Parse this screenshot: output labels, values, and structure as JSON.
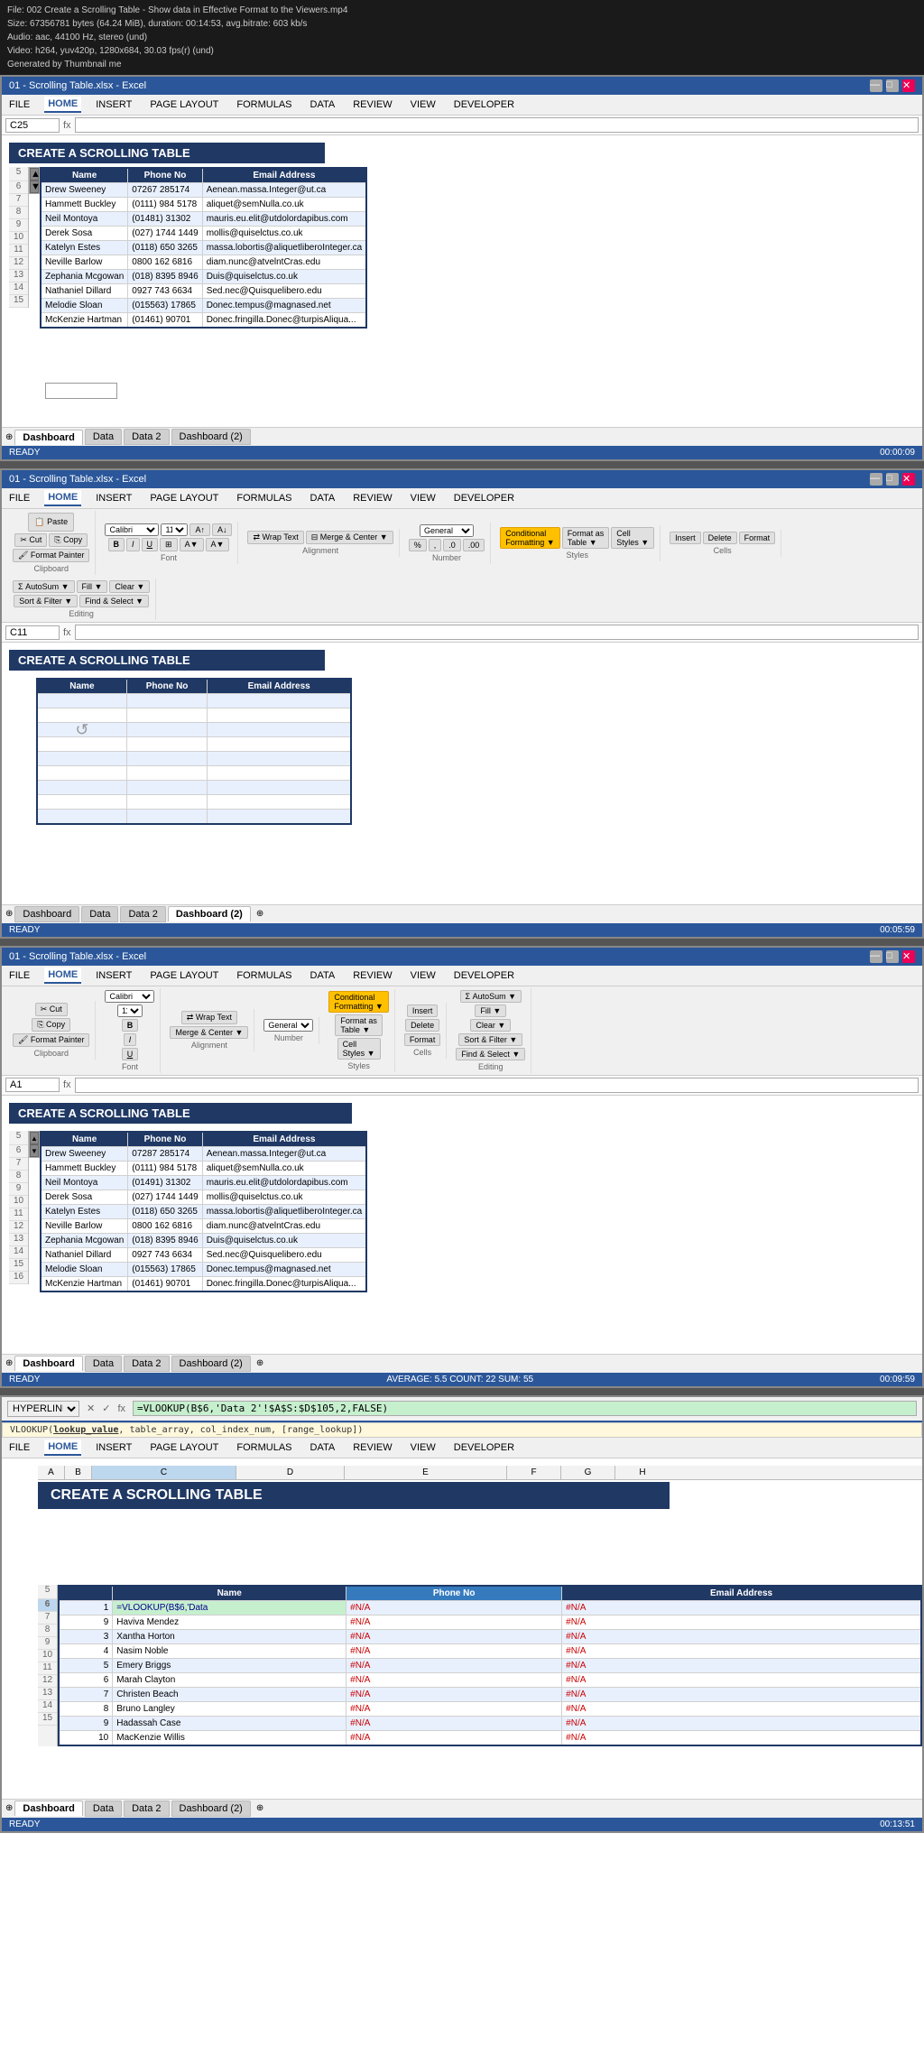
{
  "videoInfo": {
    "file": "File: 002 Create a Scrolling Table - Show data in Effective Format to the Viewers.mp4",
    "size": "Size: 67356781 bytes (64.24 MiB), duration: 00:14:53, avg.bitrate: 603 kb/s",
    "audio": "Audio: aac, 44100 Hz, stereo (und)",
    "video": "Video: h264, yuv420p, 1280x684, 30.03 fps(r) (und)",
    "generated": "Generated by Thumbnail me"
  },
  "section1": {
    "titleBar": "01 - Scrolling Table.xlsx - Excel",
    "nameBox": "C25",
    "formula": "",
    "activeTab": "HOME",
    "menuItems": [
      "FILE",
      "HOME",
      "INSERT",
      "PAGE LAYOUT",
      "FORMULAS",
      "DATA",
      "REVIEW",
      "VIEW",
      "DEVELOPER"
    ],
    "pageTitle": "CREATE A SCROLLING TABLE",
    "sheetTabs": [
      "Dashboard",
      "Data",
      "Data 2",
      "Dashboard (2)"
    ],
    "activeSheet": "Dashboard",
    "status": "READY",
    "timeCode": "00:00:09",
    "tableHeaders": [
      "Name",
      "Phone No",
      "Email Address"
    ],
    "tableData": [
      [
        "Drew Sweeney",
        "07267 285174",
        "Aenean.massa.Integer@ut.ca"
      ],
      [
        "Hammett Buckley",
        "(0111) 984 5178",
        "aliquet@semNulla.co.uk"
      ],
      [
        "Neil Montoya",
        "(01481) 31302",
        "mauris.eu.elit@utdolordapibus.com"
      ],
      [
        "Derek Sosa",
        "(027) 1744 1449",
        "mollis@quiselctus.co.uk"
      ],
      [
        "Katelyn Estes",
        "(0118) 650 3265",
        "massa.lobortis@aliquetliberoInteger.ca"
      ],
      [
        "Neville Barlow",
        "0800 162 6816",
        "diam.nunc@atvelntCras.edu"
      ],
      [
        "Zephania Mcgowan",
        "(018) 8395 8946",
        "Duis@quiselctus.co.uk"
      ],
      [
        "Nathaniel Dillard",
        "0927 743 6634",
        "Sed.nec@Quisquelibero.edu"
      ],
      [
        "Melodie Sloan",
        "(015563) 17865",
        "Donec.tempus@magnased.net"
      ],
      [
        "McKenzie Hartman",
        "(01461) 90701",
        "Donec.fringilla.Donec@turpisAliquamadipising.net"
      ]
    ]
  },
  "section2": {
    "titleBar": "01 - Scrolling Table.xlsx - Excel",
    "nameBox": "C11",
    "formula": "",
    "activeTab": "HOME",
    "menuItems": [
      "FILE",
      "HOME",
      "INSERT",
      "PAGE LAYOUT",
      "FORMULAS",
      "DATA",
      "REVIEW",
      "VIEW",
      "DEVELOPER"
    ],
    "pageTitle": "CREATE A SCROLLING TABLE",
    "sheetTabs": [
      "Dashboard",
      "Data",
      "Data 2",
      "Dashboard (2)"
    ],
    "activeSheet": "Dashboard (2)",
    "status": "READY",
    "timeCode": "00:05:59",
    "tableHeaders": [
      "Name",
      "Phone No",
      "Email Address"
    ],
    "tableData": [
      [
        "",
        "",
        ""
      ],
      [
        "",
        "",
        ""
      ],
      [
        "",
        "",
        ""
      ],
      [
        "",
        "",
        ""
      ],
      [
        "",
        "",
        ""
      ],
      [
        "",
        "",
        ""
      ],
      [
        "",
        "",
        ""
      ],
      [
        "",
        "",
        ""
      ],
      [
        "",
        "",
        ""
      ]
    ]
  },
  "section3": {
    "titleBar": "01 - Scrolling Table.xlsx - Excel",
    "nameBox": "A1",
    "formula": "",
    "activeTab": "HOME",
    "menuItems": [
      "FILE",
      "HOME",
      "INSERT",
      "PAGE LAYOUT",
      "FORMULAS",
      "DATA",
      "REVIEW",
      "VIEW",
      "DEVELOPER"
    ],
    "pageTitle": "CREATE A SCROLLING TABLE",
    "sheetTabs": [
      "Dashboard",
      "Data",
      "Data 2",
      "Dashboard (2)"
    ],
    "activeSheet": "Dashboard",
    "status": "READY",
    "timeCode": "00:09:59",
    "statusExtra": "AVERAGE: 5.5   COUNT: 22   SUM: 55",
    "tableHeaders": [
      "Name",
      "Phone No",
      "Email Address"
    ],
    "tableData": [
      [
        "Drew Sweeney",
        "07287 285174",
        "Aenean.massa.Integer@ut.ca"
      ],
      [
        "Hammett Buckley",
        "(0111) 984 5178",
        "aliquet@semNulla.co.uk"
      ],
      [
        "Neil Montoya",
        "(01491) 31302",
        "mauris.eu.elit@utdolordapibus.com"
      ],
      [
        "Derek Sosa",
        "(027) 1744 1449",
        "mollis@quiselctus.co.uk"
      ],
      [
        "Katelyn Estes",
        "(0118) 650 3265",
        "massa.lobortis@aliquetliberoInteger.ca"
      ],
      [
        "Neville Barlow",
        "0800 162 6816",
        "diam.nunc@atvelntCras.edu"
      ],
      [
        "Zephania Mcgowan",
        "(018) 8395 8946",
        "Duis@quiselctus.co.uk"
      ],
      [
        "Nathaniel Dillard",
        "0927 743 6634",
        "Sed.nec@Quisquelibero.edu"
      ],
      [
        "Melodie Sloan",
        "(015563) 17865",
        "Donec.tempus@magnased.net"
      ],
      [
        "McKenzie Hartman",
        "(01461) 90701",
        "Donec.fringilla.Donec@turpisAliquamadipising.net"
      ]
    ]
  },
  "section4": {
    "titleBar": "01 - Scrolling Table.xlsx - Excel",
    "nameBox": "HYPERLINK",
    "formula": "=VLOOKUP(B$6,'Data 2'!$A$S:$D$105,2,FALSE)",
    "formulaHint": "VLOOKUP(lookup_value, table_array, col_index_num, [range_lookup])",
    "activeTab": "HOME",
    "menuItems": [
      "FILE",
      "HOME",
      "INSERT",
      "PAGE LAYOUT",
      "FORMULAS",
      "DATA",
      "REVIEW",
      "VIEW",
      "DEVELOPER"
    ],
    "pageTitle": "CREATE A SCROLLING TABLE",
    "sheetTabs": [
      "Dashboard",
      "Data",
      "Data 2",
      "Dashboard (2)"
    ],
    "activeSheet": "Dashboard",
    "status": "READY",
    "timeCode": "00:13:51",
    "colHeaders": [
      "A",
      "B",
      "C",
      "D",
      "E",
      "F",
      "G",
      "H"
    ],
    "tableHeaders": [
      "Name",
      "Phone No",
      "Email Address"
    ],
    "tableData": [
      [
        "1",
        "=VLOOKUP(B$6,'Data",
        "#N/A",
        "#N/A"
      ],
      [
        "9",
        "Haviva Mendez",
        "#N/A",
        "#N/A"
      ],
      [
        "3",
        "Xantha Horton",
        "#N/A",
        "#N/A"
      ],
      [
        "4",
        "Nasim Noble",
        "#N/A",
        "#N/A"
      ],
      [
        "5",
        "Emery Briggs",
        "#N/A",
        "#N/A"
      ],
      [
        "6",
        "Marah Clayton",
        "#N/A",
        "#N/A"
      ],
      [
        "7",
        "Christen Beach",
        "#N/A",
        "#N/A"
      ],
      [
        "8",
        "Bruno Langley",
        "#N/A",
        "#N/A"
      ],
      [
        "9",
        "Hadassah Case",
        "#N/A",
        "#N/A"
      ],
      [
        "10",
        "MacKenzie Willis",
        "#N/A",
        "#N/A"
      ]
    ]
  },
  "icons": {
    "minimize": "—",
    "maximize": "□",
    "close": "✕",
    "scrollUp": "▲",
    "scrollDown": "▼",
    "check": "✓",
    "cross": "✕",
    "fx": "fx"
  }
}
